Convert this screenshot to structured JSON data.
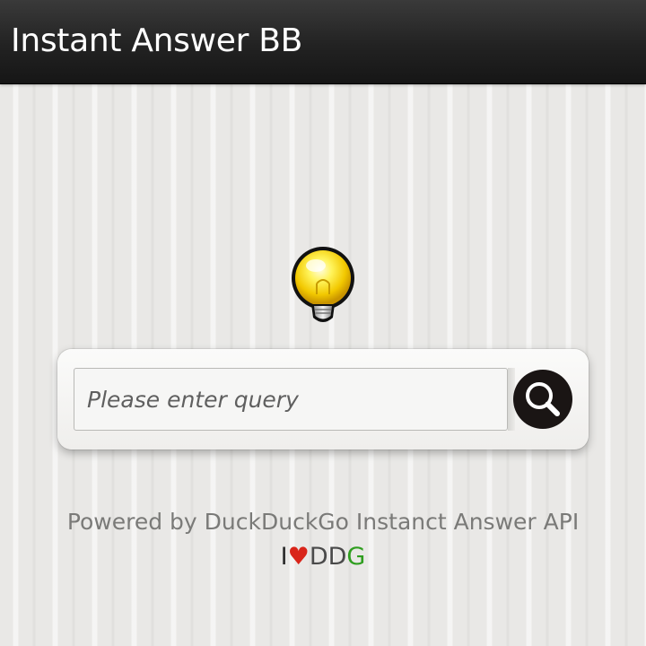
{
  "app": {
    "title": "Instant Answer BB"
  },
  "hero": {
    "icon": "lightbulb-icon"
  },
  "search": {
    "placeholder": "Please enter query",
    "value": "",
    "button_icon": "search-icon"
  },
  "footer": {
    "powered_by": "Powered by DuckDuckGo Instanct Answer API",
    "love_prefix": "I",
    "love_symbol": "♥",
    "love_dd": "DD",
    "love_g": "G"
  },
  "colors": {
    "title_bar": "#1f1f1f",
    "heart": "#d9251a",
    "ddg_green": "#2f9e1f",
    "search_button": "#1a1514"
  }
}
